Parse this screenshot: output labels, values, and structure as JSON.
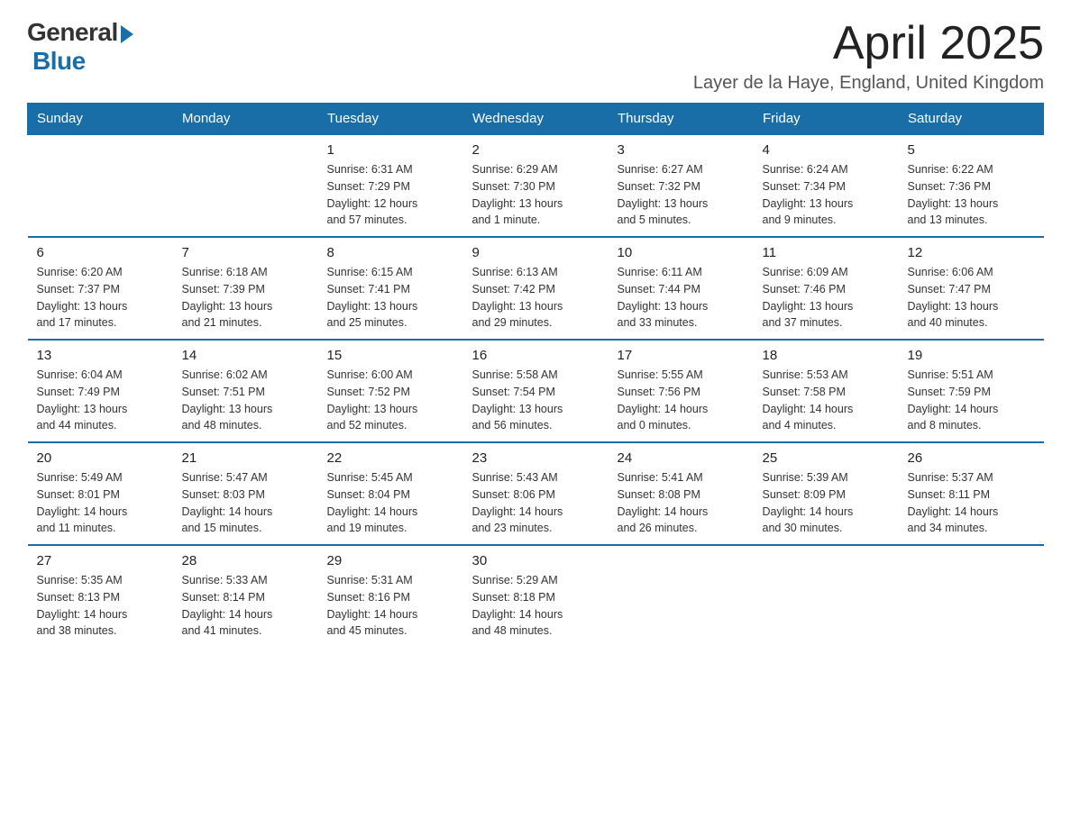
{
  "logo": {
    "general": "General",
    "blue": "Blue",
    "tagline": "Blue"
  },
  "title": "April 2025",
  "location": "Layer de la Haye, England, United Kingdom",
  "weekdays": [
    "Sunday",
    "Monday",
    "Tuesday",
    "Wednesday",
    "Thursday",
    "Friday",
    "Saturday"
  ],
  "weeks": [
    [
      {
        "day": "",
        "info": ""
      },
      {
        "day": "",
        "info": ""
      },
      {
        "day": "1",
        "info": "Sunrise: 6:31 AM\nSunset: 7:29 PM\nDaylight: 12 hours\nand 57 minutes."
      },
      {
        "day": "2",
        "info": "Sunrise: 6:29 AM\nSunset: 7:30 PM\nDaylight: 13 hours\nand 1 minute."
      },
      {
        "day": "3",
        "info": "Sunrise: 6:27 AM\nSunset: 7:32 PM\nDaylight: 13 hours\nand 5 minutes."
      },
      {
        "day": "4",
        "info": "Sunrise: 6:24 AM\nSunset: 7:34 PM\nDaylight: 13 hours\nand 9 minutes."
      },
      {
        "day": "5",
        "info": "Sunrise: 6:22 AM\nSunset: 7:36 PM\nDaylight: 13 hours\nand 13 minutes."
      }
    ],
    [
      {
        "day": "6",
        "info": "Sunrise: 6:20 AM\nSunset: 7:37 PM\nDaylight: 13 hours\nand 17 minutes."
      },
      {
        "day": "7",
        "info": "Sunrise: 6:18 AM\nSunset: 7:39 PM\nDaylight: 13 hours\nand 21 minutes."
      },
      {
        "day": "8",
        "info": "Sunrise: 6:15 AM\nSunset: 7:41 PM\nDaylight: 13 hours\nand 25 minutes."
      },
      {
        "day": "9",
        "info": "Sunrise: 6:13 AM\nSunset: 7:42 PM\nDaylight: 13 hours\nand 29 minutes."
      },
      {
        "day": "10",
        "info": "Sunrise: 6:11 AM\nSunset: 7:44 PM\nDaylight: 13 hours\nand 33 minutes."
      },
      {
        "day": "11",
        "info": "Sunrise: 6:09 AM\nSunset: 7:46 PM\nDaylight: 13 hours\nand 37 minutes."
      },
      {
        "day": "12",
        "info": "Sunrise: 6:06 AM\nSunset: 7:47 PM\nDaylight: 13 hours\nand 40 minutes."
      }
    ],
    [
      {
        "day": "13",
        "info": "Sunrise: 6:04 AM\nSunset: 7:49 PM\nDaylight: 13 hours\nand 44 minutes."
      },
      {
        "day": "14",
        "info": "Sunrise: 6:02 AM\nSunset: 7:51 PM\nDaylight: 13 hours\nand 48 minutes."
      },
      {
        "day": "15",
        "info": "Sunrise: 6:00 AM\nSunset: 7:52 PM\nDaylight: 13 hours\nand 52 minutes."
      },
      {
        "day": "16",
        "info": "Sunrise: 5:58 AM\nSunset: 7:54 PM\nDaylight: 13 hours\nand 56 minutes."
      },
      {
        "day": "17",
        "info": "Sunrise: 5:55 AM\nSunset: 7:56 PM\nDaylight: 14 hours\nand 0 minutes."
      },
      {
        "day": "18",
        "info": "Sunrise: 5:53 AM\nSunset: 7:58 PM\nDaylight: 14 hours\nand 4 minutes."
      },
      {
        "day": "19",
        "info": "Sunrise: 5:51 AM\nSunset: 7:59 PM\nDaylight: 14 hours\nand 8 minutes."
      }
    ],
    [
      {
        "day": "20",
        "info": "Sunrise: 5:49 AM\nSunset: 8:01 PM\nDaylight: 14 hours\nand 11 minutes."
      },
      {
        "day": "21",
        "info": "Sunrise: 5:47 AM\nSunset: 8:03 PM\nDaylight: 14 hours\nand 15 minutes."
      },
      {
        "day": "22",
        "info": "Sunrise: 5:45 AM\nSunset: 8:04 PM\nDaylight: 14 hours\nand 19 minutes."
      },
      {
        "day": "23",
        "info": "Sunrise: 5:43 AM\nSunset: 8:06 PM\nDaylight: 14 hours\nand 23 minutes."
      },
      {
        "day": "24",
        "info": "Sunrise: 5:41 AM\nSunset: 8:08 PM\nDaylight: 14 hours\nand 26 minutes."
      },
      {
        "day": "25",
        "info": "Sunrise: 5:39 AM\nSunset: 8:09 PM\nDaylight: 14 hours\nand 30 minutes."
      },
      {
        "day": "26",
        "info": "Sunrise: 5:37 AM\nSunset: 8:11 PM\nDaylight: 14 hours\nand 34 minutes."
      }
    ],
    [
      {
        "day": "27",
        "info": "Sunrise: 5:35 AM\nSunset: 8:13 PM\nDaylight: 14 hours\nand 38 minutes."
      },
      {
        "day": "28",
        "info": "Sunrise: 5:33 AM\nSunset: 8:14 PM\nDaylight: 14 hours\nand 41 minutes."
      },
      {
        "day": "29",
        "info": "Sunrise: 5:31 AM\nSunset: 8:16 PM\nDaylight: 14 hours\nand 45 minutes."
      },
      {
        "day": "30",
        "info": "Sunrise: 5:29 AM\nSunset: 8:18 PM\nDaylight: 14 hours\nand 48 minutes."
      },
      {
        "day": "",
        "info": ""
      },
      {
        "day": "",
        "info": ""
      },
      {
        "day": "",
        "info": ""
      }
    ]
  ]
}
